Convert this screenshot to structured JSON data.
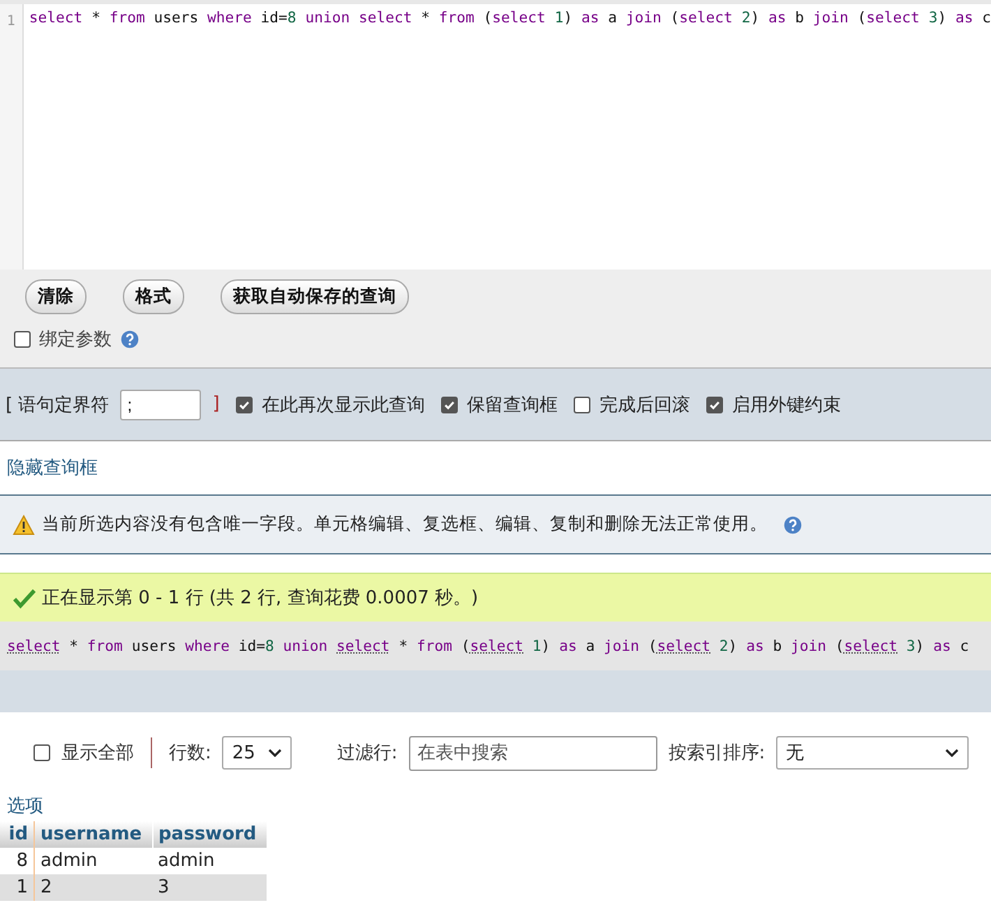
{
  "editor": {
    "line_number": "1",
    "tokens": [
      {
        "text": "select",
        "kind": "keyword"
      },
      {
        "text": " * ",
        "kind": "plain"
      },
      {
        "text": "from",
        "kind": "keyword"
      },
      {
        "text": " users ",
        "kind": "plain"
      },
      {
        "text": "where",
        "kind": "keyword"
      },
      {
        "text": " id=",
        "kind": "plain"
      },
      {
        "text": "8 ",
        "kind": "number"
      },
      {
        "text": "union select",
        "kind": "keyword"
      },
      {
        "text": " * ",
        "kind": "plain"
      },
      {
        "text": "from",
        "kind": "keyword"
      },
      {
        "text": " (",
        "kind": "plain"
      },
      {
        "text": "select ",
        "kind": "keyword"
      },
      {
        "text": "1",
        "kind": "number"
      },
      {
        "text": ") ",
        "kind": "plain"
      },
      {
        "text": "as",
        "kind": "keyword"
      },
      {
        "text": " a ",
        "kind": "plain"
      },
      {
        "text": "join",
        "kind": "keyword"
      },
      {
        "text": " (",
        "kind": "plain"
      },
      {
        "text": "select ",
        "kind": "keyword"
      },
      {
        "text": "2",
        "kind": "number"
      },
      {
        "text": ") ",
        "kind": "plain"
      },
      {
        "text": "as",
        "kind": "keyword"
      },
      {
        "text": " b ",
        "kind": "plain"
      },
      {
        "text": "join",
        "kind": "keyword"
      },
      {
        "text": " (",
        "kind": "plain"
      },
      {
        "text": "select ",
        "kind": "keyword"
      },
      {
        "text": "3",
        "kind": "number"
      },
      {
        "text": ") ",
        "kind": "plain"
      },
      {
        "text": "as",
        "kind": "keyword"
      },
      {
        "text": " c",
        "kind": "plain"
      }
    ]
  },
  "buttons": [
    "清除",
    "格式",
    "获取自动保存的查询"
  ],
  "bind_params": {
    "label": "绑定参数",
    "checked": false
  },
  "delimiter": {
    "label": "[ 语句定界符",
    "value": ";",
    "close": "]"
  },
  "options": [
    {
      "label": "在此再次显示此查询",
      "checked": true
    },
    {
      "label": "保留查询框",
      "checked": true
    },
    {
      "label": "完成后回滚",
      "checked": false
    },
    {
      "label": "启用外键约束",
      "checked": true
    }
  ],
  "hide_link": "隐藏查询框",
  "warning": "当前所选内容没有包含唯一字段。单元格编辑、复选框、编辑、复制和删除无法正常使用。",
  "success": "正在显示第 0 - 1 行 (共 2 行, 查询花费 0.0007 秒。)",
  "query_echo": [
    {
      "text": "select",
      "kind": "link"
    },
    {
      "text": " * ",
      "kind": "plain"
    },
    {
      "text": "from",
      "kind": "keyword"
    },
    {
      "text": " users ",
      "kind": "plain"
    },
    {
      "text": "where",
      "kind": "keyword"
    },
    {
      "text": " id=",
      "kind": "plain"
    },
    {
      "text": "8 ",
      "kind": "number"
    },
    {
      "text": "union ",
      "kind": "keyword"
    },
    {
      "text": "select",
      "kind": "link"
    },
    {
      "text": " * ",
      "kind": "plain"
    },
    {
      "text": "from",
      "kind": "keyword"
    },
    {
      "text": " (",
      "kind": "plain"
    },
    {
      "text": "select",
      "kind": "link"
    },
    {
      "text": " 1",
      "kind": "number"
    },
    {
      "text": ") ",
      "kind": "plain"
    },
    {
      "text": "as",
      "kind": "keyword"
    },
    {
      "text": " a ",
      "kind": "plain"
    },
    {
      "text": "join",
      "kind": "keyword"
    },
    {
      "text": " (",
      "kind": "plain"
    },
    {
      "text": "select",
      "kind": "link"
    },
    {
      "text": " 2",
      "kind": "number"
    },
    {
      "text": ") ",
      "kind": "plain"
    },
    {
      "text": "as",
      "kind": "keyword"
    },
    {
      "text": " b ",
      "kind": "plain"
    },
    {
      "text": "join",
      "kind": "keyword"
    },
    {
      "text": " (",
      "kind": "plain"
    },
    {
      "text": "select",
      "kind": "link"
    },
    {
      "text": " 3",
      "kind": "number"
    },
    {
      "text": ") ",
      "kind": "plain"
    },
    {
      "text": "as",
      "kind": "keyword"
    },
    {
      "text": " c",
      "kind": "plain"
    }
  ],
  "navigation": {
    "show_all": {
      "label": "显示全部",
      "checked": false
    },
    "rows_label": "行数:",
    "rows_value": "25",
    "filter_label": "过滤行:",
    "filter_placeholder": "在表中搜索",
    "sort_label": "按索引排序:",
    "sort_value": "无"
  },
  "options_link": "选项",
  "table": {
    "columns": [
      "id",
      "username",
      "password"
    ],
    "rows": [
      [
        "8",
        "admin",
        "admin"
      ],
      [
        "1",
        "2",
        "3"
      ]
    ]
  }
}
